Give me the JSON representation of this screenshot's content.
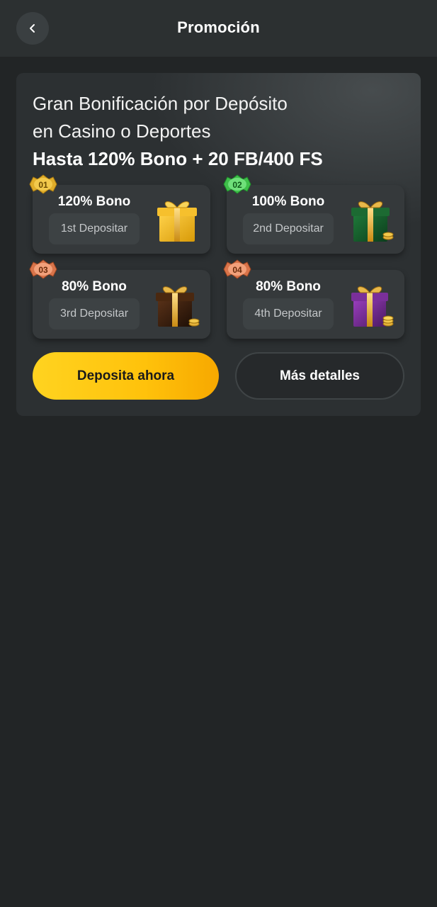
{
  "header": {
    "title": "Promoción",
    "back_icon": "chevron-left-icon"
  },
  "promo": {
    "title_line1": "Gran Bonificación por Depósito",
    "title_line2": "en Casino o Deportes",
    "title_line3": "Hasta 120% Bono + 20 FB/400 FS",
    "tiers": [
      {
        "badge": "01",
        "amount": "120% Bono",
        "label": "1st Depositar",
        "gift_color": "gold",
        "badge_color": "gold"
      },
      {
        "badge": "02",
        "amount": "100% Bono",
        "label": "2nd Depositar",
        "gift_color": "green",
        "badge_color": "green"
      },
      {
        "badge": "03",
        "amount": "80% Bono",
        "label": "3rd Depositar",
        "gift_color": "brown",
        "badge_color": "copper"
      },
      {
        "badge": "04",
        "amount": "80% Bono",
        "label": "4th Depositar",
        "gift_color": "purple",
        "badge_color": "copper"
      }
    ],
    "buttons": {
      "deposit": "Deposita ahora",
      "details": "Más detalles"
    }
  },
  "colors": {
    "accent": "#ffc20b",
    "background": "#222526",
    "card": "#2c3032"
  }
}
